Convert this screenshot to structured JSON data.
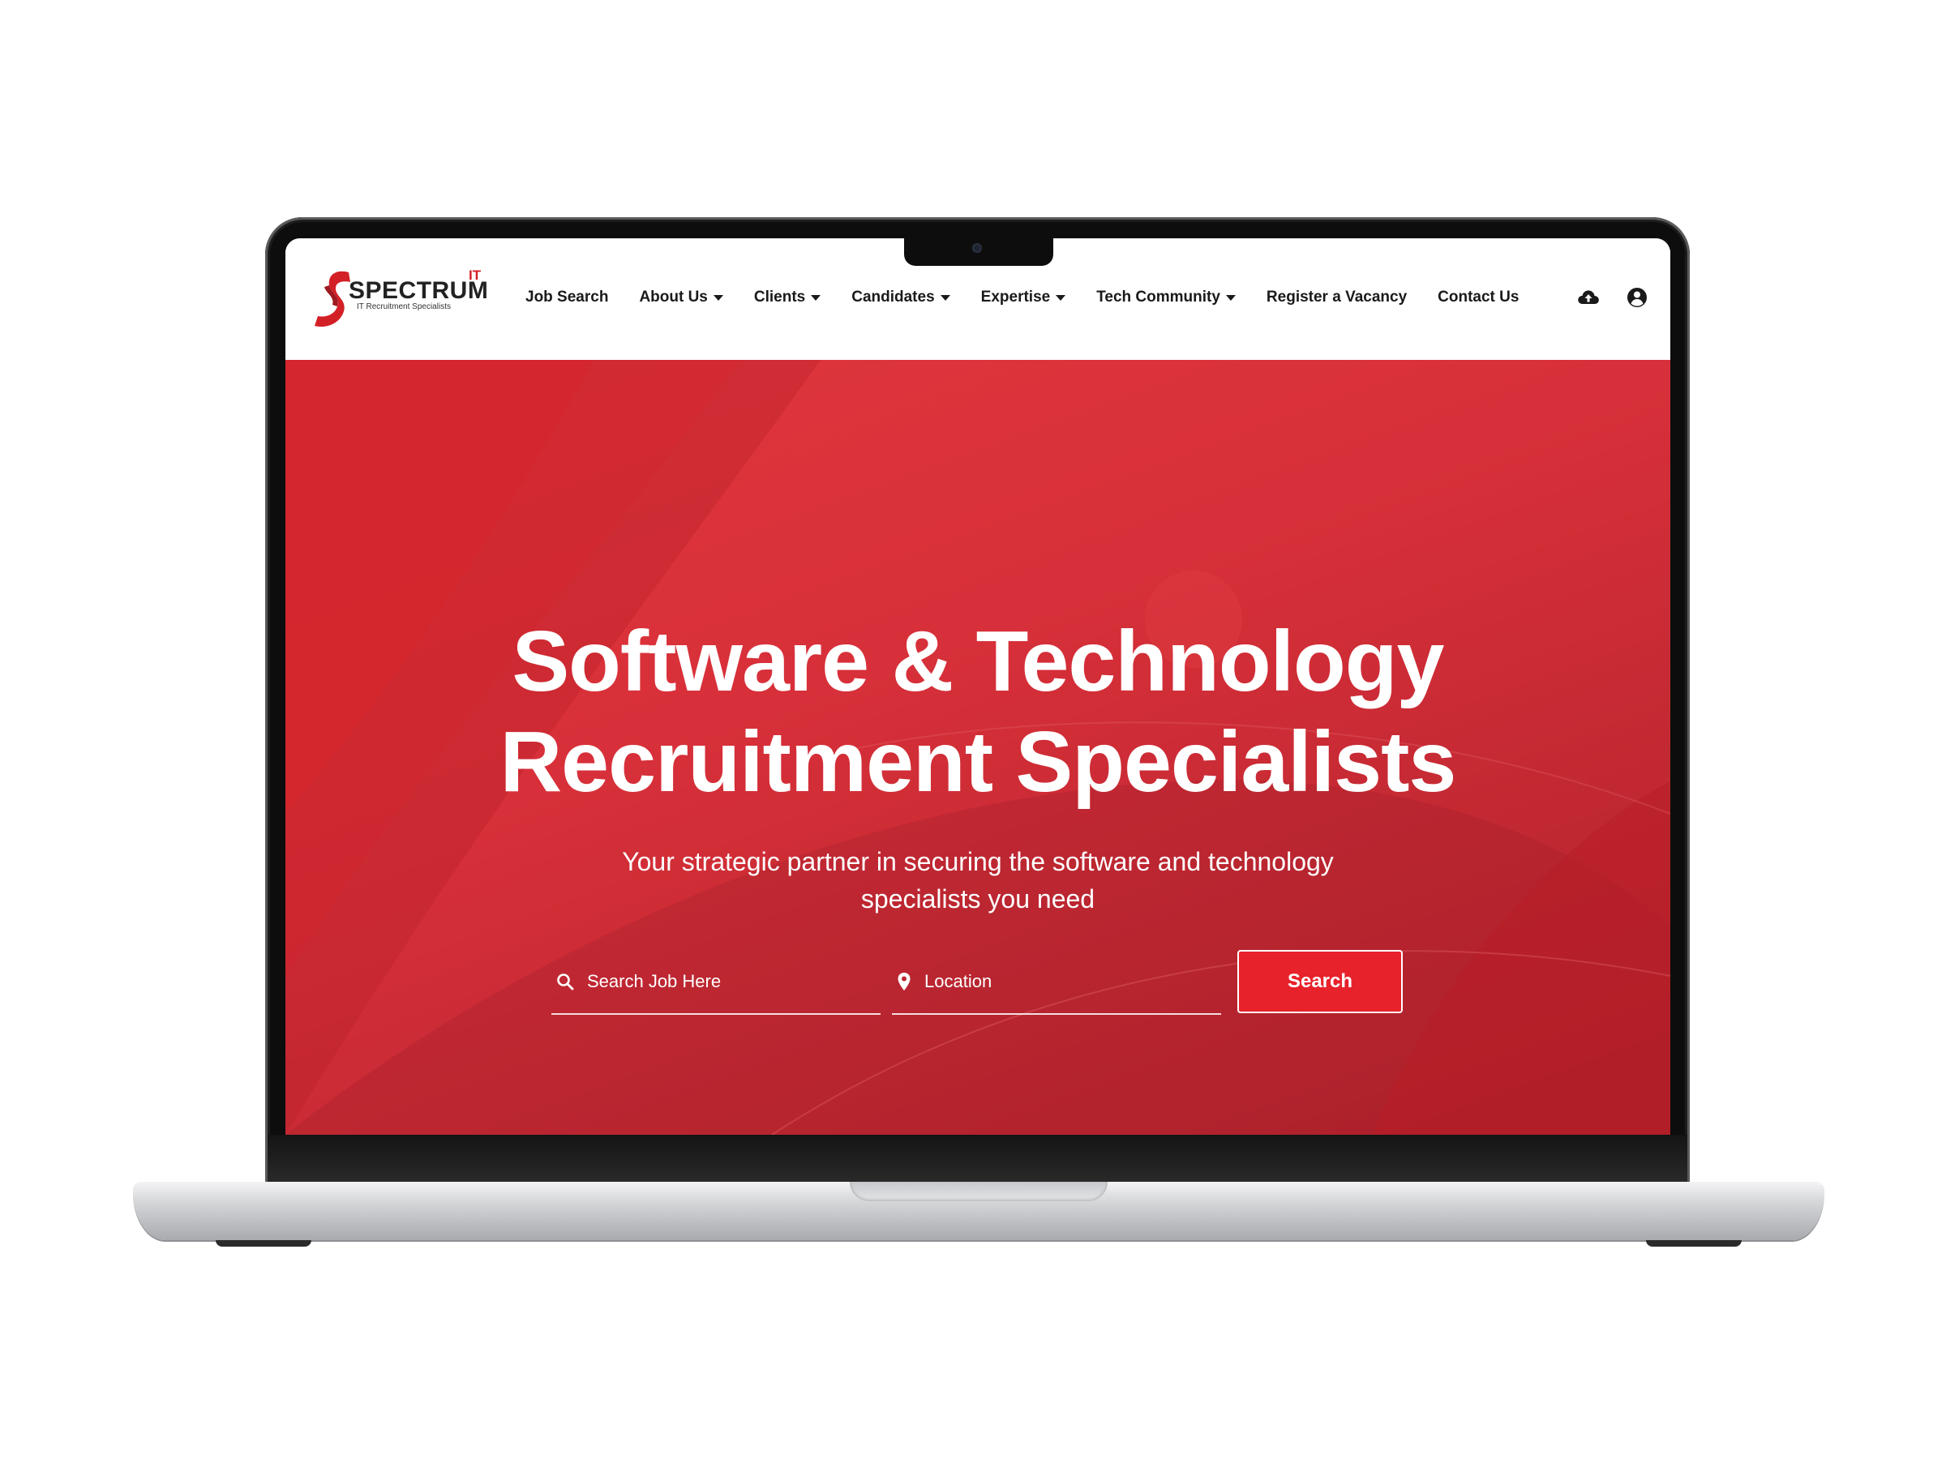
{
  "brand": {
    "name": "SPECTRUM",
    "superscript": "IT",
    "tagline": "IT Recruitment Specialists",
    "primary_color": "#e8222b"
  },
  "nav": {
    "items": [
      {
        "label": "Job Search",
        "has_dropdown": false
      },
      {
        "label": "About Us",
        "has_dropdown": true
      },
      {
        "label": "Clients",
        "has_dropdown": true
      },
      {
        "label": "Candidates",
        "has_dropdown": true
      },
      {
        "label": "Expertise",
        "has_dropdown": true
      },
      {
        "label": "Tech Community",
        "has_dropdown": true
      },
      {
        "label": "Register a Vacancy",
        "has_dropdown": false
      },
      {
        "label": "Contact Us",
        "has_dropdown": false
      }
    ],
    "icons": [
      "cloud-upload-icon",
      "account-icon"
    ]
  },
  "hero": {
    "title_line1": "Software & Technology",
    "title_line2": "Recruitment Specialists",
    "subtitle": "Your strategic partner in securing the software and technology specialists you need"
  },
  "search": {
    "job_placeholder": "Search Job Here",
    "location_placeholder": "Location",
    "button_label": "Search",
    "job_icon": "search-icon",
    "location_icon": "map-pin-icon"
  }
}
